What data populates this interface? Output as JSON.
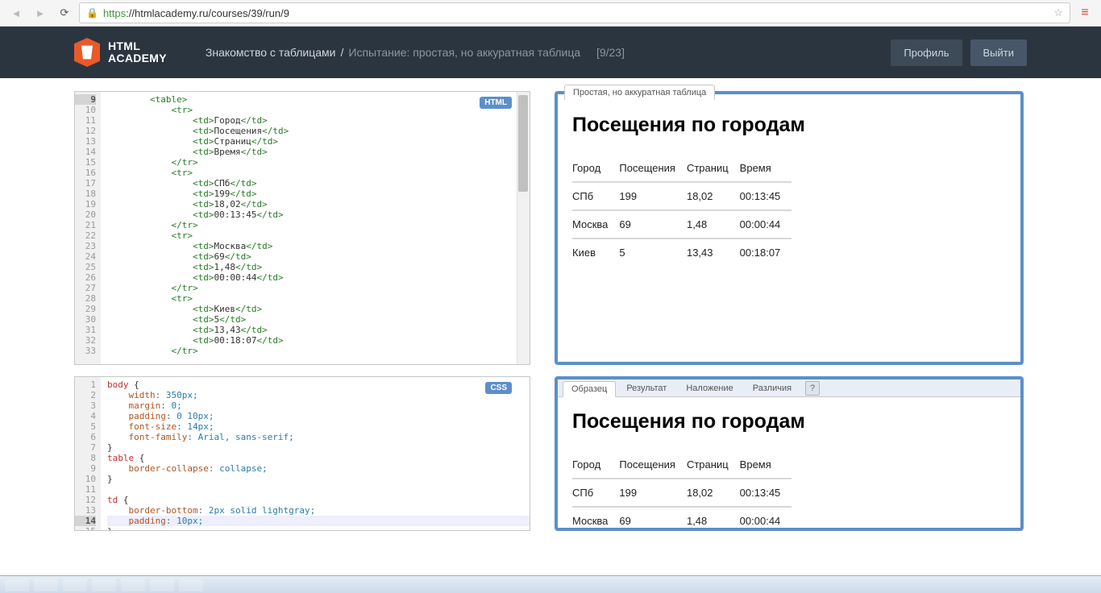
{
  "browser": {
    "url_https": "https",
    "url_rest": "://htmlacademy.ru/courses/39/run/9"
  },
  "header": {
    "logo_line1": "HTML",
    "logo_line2": "ACADEMY",
    "crumb_course": "Знакомство с таблицами",
    "crumb_sep": "/",
    "crumb_task": "Испытание: простая, но аккуратная таблица",
    "crumb_pos": "[9/23]",
    "btn_profile": "Профиль",
    "btn_logout": "Выйти"
  },
  "editor_html": {
    "badge": "HTML",
    "first_line": 9,
    "lines": [
      "        <table>",
      "            <tr>",
      "                <td>Город</td>",
      "                <td>Посещения</td>",
      "                <td>Страниц</td>",
      "                <td>Время</td>",
      "            </tr>",
      "            <tr>",
      "                <td>СПб</td>",
      "                <td>199</td>",
      "                <td>18,02</td>",
      "                <td>00:13:45</td>",
      "            </tr>",
      "            <tr>",
      "                <td>Москва</td>",
      "                <td>69</td>",
      "                <td>1,48</td>",
      "                <td>00:00:44</td>",
      "            </tr>",
      "            <tr>",
      "                <td>Киев</td>",
      "                <td>5</td>",
      "                <td>13,43</td>",
      "                <td>00:18:07</td>",
      "            </tr>"
    ]
  },
  "editor_css": {
    "badge": "CSS",
    "first_line": 1,
    "highlight_line": 14,
    "lines": [
      {
        "sel": "body",
        "punct": " {"
      },
      {
        "prop": "    width",
        "val": ": 350px;"
      },
      {
        "prop": "    margin",
        "val": ": 0;"
      },
      {
        "prop": "    padding",
        "val": ": 0 10px;"
      },
      {
        "prop": "    font-size",
        "val": ": 14px;"
      },
      {
        "prop": "    font-family",
        "val": ": Arial, sans-serif;"
      },
      {
        "punct": "}"
      },
      {
        "sel": "table",
        "punct": " {"
      },
      {
        "prop": "    border-collapse",
        "val": ": collapse;"
      },
      {
        "punct": "}"
      },
      {
        "punct": ""
      },
      {
        "sel": "td",
        "punct": " {"
      },
      {
        "prop": "    border-bottom",
        "val": ": 2px solid lightgray;"
      },
      {
        "prop": "    padding",
        "val": ": 10px;"
      },
      {
        "punct": "}"
      }
    ]
  },
  "preview": {
    "tab_label": "Простая, но аккуратная таблица",
    "title": "Посещения по городам",
    "headers": [
      "Город",
      "Посещения",
      "Страниц",
      "Время"
    ],
    "rows": [
      [
        "СПб",
        "199",
        "18,02",
        "00:13:45"
      ],
      [
        "Москва",
        "69",
        "1,48",
        "00:00:44"
      ],
      [
        "Киев",
        "5",
        "13,43",
        "00:18:07"
      ]
    ]
  },
  "compare_tabs": {
    "t1": "Образец",
    "t2": "Результат",
    "t3": "Наложение",
    "t4": "Различия",
    "help": "?"
  }
}
